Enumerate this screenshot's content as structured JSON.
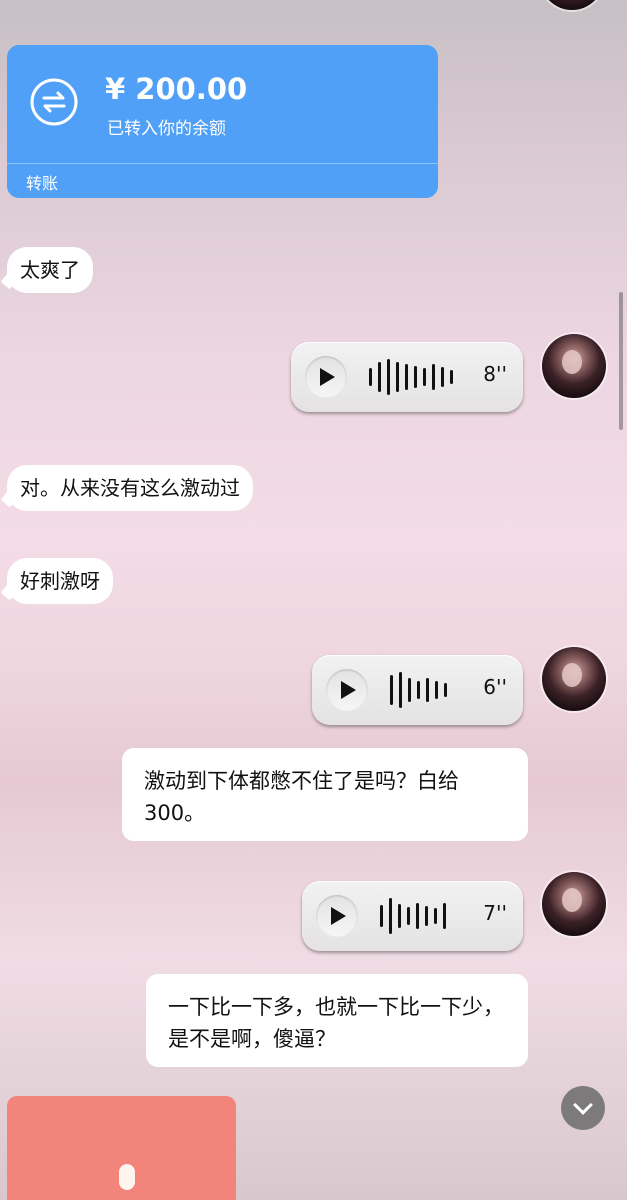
{
  "transfer": {
    "amount": "¥ 200.00",
    "note": "已转入你的余额",
    "label": "转账"
  },
  "messages": {
    "m1": "太爽了",
    "m2": "对。从来没有这么激动过",
    "m3": "好刺激呀",
    "m4": "激动到下体都憋不住了是吗？白给300。",
    "m5": "一下比一下多，也就一下比一下少，是不是啊，傻逼？"
  },
  "voices": {
    "v1": "8''",
    "v2": "6''",
    "v3": "7''"
  },
  "colors": {
    "transfer_bg": "#4fa0f6",
    "red_card": "#f2847c"
  }
}
